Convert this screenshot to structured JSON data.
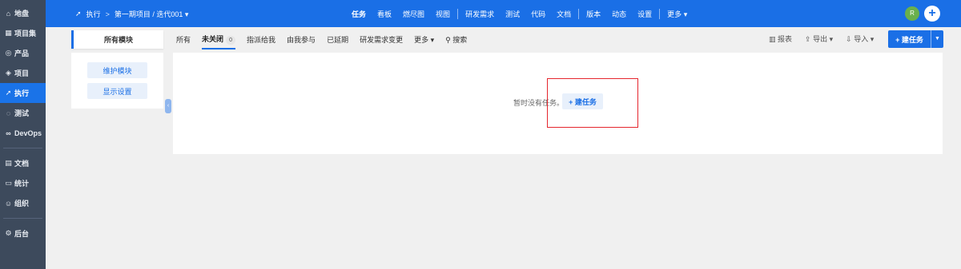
{
  "sidebar": {
    "items": [
      {
        "icon": "home-icon",
        "glyph": "⌂",
        "label": "地盘"
      },
      {
        "icon": "grid-icon",
        "glyph": "▦",
        "label": "项目集"
      },
      {
        "icon": "product-icon",
        "glyph": "◎",
        "label": "产品"
      },
      {
        "icon": "project-icon",
        "glyph": "◈",
        "label": "项目"
      },
      {
        "icon": "execution-icon",
        "glyph": "➚",
        "label": "执行",
        "active": true
      },
      {
        "icon": "test-icon",
        "glyph": "◌",
        "label": "测试"
      },
      {
        "icon": "devops-icon",
        "glyph": "∞",
        "label": "DevOps"
      },
      {
        "icon": "doc-icon",
        "glyph": "▤",
        "label": "文档"
      },
      {
        "icon": "stats-icon",
        "glyph": "▭",
        "label": "统计"
      },
      {
        "icon": "org-icon",
        "glyph": "☺",
        "label": "组织"
      },
      {
        "icon": "admin-icon",
        "glyph": "⚙",
        "label": "后台"
      }
    ]
  },
  "topbar": {
    "breadcrumb_icon": "execution-icon",
    "breadcrumb_root": "执行",
    "breadcrumb_sep": ">",
    "breadcrumb_path": "第一期项目 / 迭代001",
    "nav": [
      "任务",
      "看板",
      "燃尽图",
      "视图",
      "研发需求",
      "测试",
      "代码",
      "文档",
      "版本",
      "动态",
      "设置",
      "更多"
    ],
    "active_nav": "任务",
    "avatar_letter": "R",
    "colors": {
      "bar": "#1a6fe6",
      "sidebar": "#3d4a5c",
      "avatar": "#6ab04c",
      "highlight": "#e5262d"
    }
  },
  "toolbar": {
    "module_tab": "所有模块",
    "filters": [
      "所有",
      "未关闭",
      "指派给我",
      "由我参与",
      "已延期",
      "研发需求变更",
      "更多"
    ],
    "active_filter": "未关闭",
    "unclosed_count": "0",
    "search_label": "搜索",
    "report_label": "报表",
    "export_label": "导出",
    "import_label": "导入",
    "new_task_label": "+ 建任务"
  },
  "module_panel": {
    "maintain_label": "维护模块",
    "display_label": "显示设置"
  },
  "empty_state": {
    "text": "暂时没有任务。",
    "button_label": "+ 建任务"
  }
}
